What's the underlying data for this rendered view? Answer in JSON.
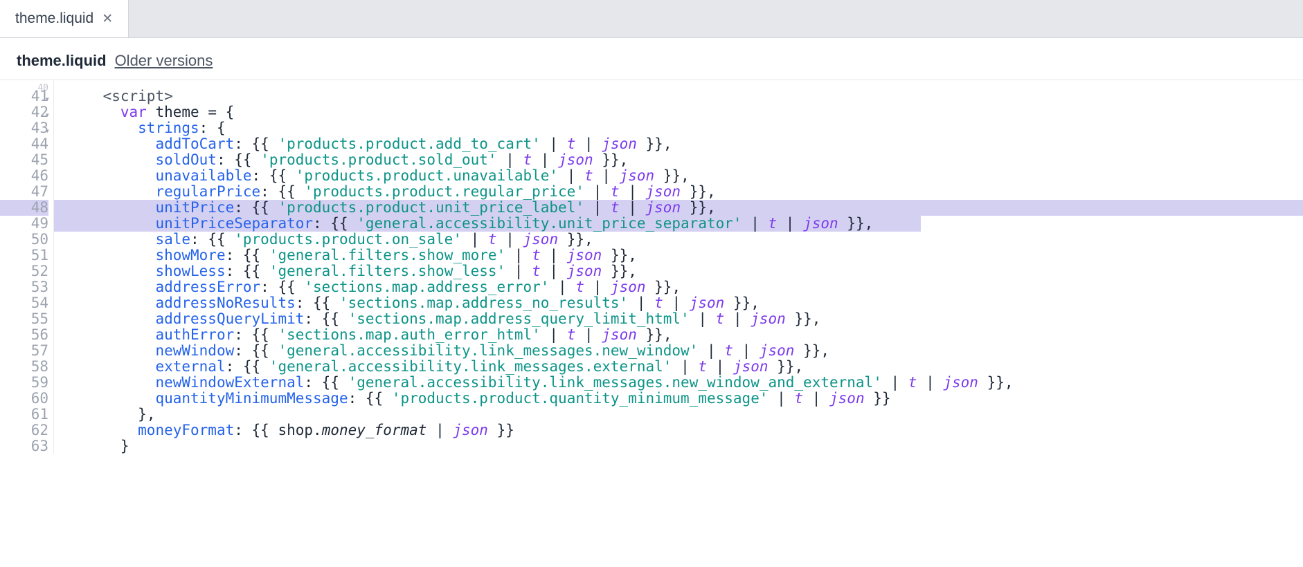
{
  "tab": {
    "title": "theme.liquid",
    "close": "✕"
  },
  "breadcrumb": {
    "file": "theme.liquid",
    "older": "Older versions"
  },
  "gutter_stub": "40",
  "code_lines": [
    {
      "n": "41",
      "fold": true,
      "hl": false,
      "indent": "    ",
      "segs": [
        {
          "t": "<",
          "c": "k-tag"
        },
        {
          "t": "script",
          "c": "k-tag"
        },
        {
          "t": ">",
          "c": "k-tag"
        }
      ]
    },
    {
      "n": "42",
      "fold": true,
      "hl": false,
      "indent": "      ",
      "segs": [
        {
          "t": "var",
          "c": "k-var"
        },
        {
          "t": " theme "
        },
        {
          "t": "=",
          "c": ""
        },
        {
          "t": " "
        },
        {
          "t": "{",
          "c": "k-br"
        }
      ]
    },
    {
      "n": "43",
      "fold": true,
      "hl": false,
      "indent": "        ",
      "segs": [
        {
          "t": "strings",
          "c": "k-prop"
        },
        {
          "t": ": "
        },
        {
          "t": "{",
          "c": "k-br"
        }
      ]
    },
    {
      "n": "44",
      "fold": false,
      "hl": false,
      "indent": "          ",
      "segs": [
        {
          "t": "addToCart",
          "c": "k-prop"
        },
        {
          "t": ": "
        },
        {
          "t": "{{ ",
          "c": "k-br"
        },
        {
          "t": "'products.product.add_to_cart'",
          "c": "k-str"
        },
        {
          "t": " | "
        },
        {
          "t": "t",
          "c": "k-filt"
        },
        {
          "t": " | "
        },
        {
          "t": "json",
          "c": "k-filt"
        },
        {
          "t": " }}",
          "c": "k-br"
        },
        {
          "t": ","
        }
      ]
    },
    {
      "n": "45",
      "fold": false,
      "hl": false,
      "indent": "          ",
      "segs": [
        {
          "t": "soldOut",
          "c": "k-prop"
        },
        {
          "t": ": "
        },
        {
          "t": "{{ ",
          "c": "k-br"
        },
        {
          "t": "'products.product.sold_out'",
          "c": "k-str"
        },
        {
          "t": " | "
        },
        {
          "t": "t",
          "c": "k-filt"
        },
        {
          "t": " | "
        },
        {
          "t": "json",
          "c": "k-filt"
        },
        {
          "t": " }}",
          "c": "k-br"
        },
        {
          "t": ","
        }
      ]
    },
    {
      "n": "46",
      "fold": false,
      "hl": false,
      "indent": "          ",
      "segs": [
        {
          "t": "unavailable",
          "c": "k-prop"
        },
        {
          "t": ": "
        },
        {
          "t": "{{ ",
          "c": "k-br"
        },
        {
          "t": "'products.product.unavailable'",
          "c": "k-str"
        },
        {
          "t": " | "
        },
        {
          "t": "t",
          "c": "k-filt"
        },
        {
          "t": " | "
        },
        {
          "t": "json",
          "c": "k-filt"
        },
        {
          "t": " }}",
          "c": "k-br"
        },
        {
          "t": ","
        }
      ]
    },
    {
      "n": "47",
      "fold": false,
      "hl": false,
      "indent": "          ",
      "segs": [
        {
          "t": "regularPrice",
          "c": "k-prop"
        },
        {
          "t": ": "
        },
        {
          "t": "{{ ",
          "c": "k-br"
        },
        {
          "t": "'products.product.regular_price'",
          "c": "k-str"
        },
        {
          "t": " | "
        },
        {
          "t": "t",
          "c": "k-filt"
        },
        {
          "t": " | "
        },
        {
          "t": "json",
          "c": "k-filt"
        },
        {
          "t": " }}",
          "c": "k-br"
        },
        {
          "t": ","
        }
      ]
    },
    {
      "n": "48",
      "fold": false,
      "hl": true,
      "indent": "          ",
      "segs": [
        {
          "t": "unitPrice",
          "c": "k-prop"
        },
        {
          "t": ": "
        },
        {
          "t": "{{ ",
          "c": "k-br"
        },
        {
          "t": "'products.product.unit_price_label'",
          "c": "k-str"
        },
        {
          "t": " | "
        },
        {
          "t": "t",
          "c": "k-filt"
        },
        {
          "t": " | "
        },
        {
          "t": "json",
          "c": "k-filt"
        },
        {
          "t": " }}",
          "c": "k-br"
        },
        {
          "t": ","
        }
      ]
    },
    {
      "n": "49",
      "fold": false,
      "hl": "partial",
      "indent": "          ",
      "segs": [
        {
          "t": "unitPriceSeparator",
          "c": "k-prop"
        },
        {
          "t": ": "
        },
        {
          "t": "{{ ",
          "c": "k-br"
        },
        {
          "t": "'general.accessibility.unit_price_separator'",
          "c": "k-str"
        },
        {
          "t": " | "
        },
        {
          "t": "t",
          "c": "k-filt"
        },
        {
          "t": " | "
        },
        {
          "t": "json",
          "c": "k-filt"
        },
        {
          "t": " }}",
          "c": "k-br"
        },
        {
          "t": ","
        }
      ]
    },
    {
      "n": "50",
      "fold": false,
      "hl": false,
      "indent": "          ",
      "segs": [
        {
          "t": "sale",
          "c": "k-prop"
        },
        {
          "t": ": "
        },
        {
          "t": "{{ ",
          "c": "k-br"
        },
        {
          "t": "'products.product.on_sale'",
          "c": "k-str"
        },
        {
          "t": " | "
        },
        {
          "t": "t",
          "c": "k-filt"
        },
        {
          "t": " | "
        },
        {
          "t": "json",
          "c": "k-filt"
        },
        {
          "t": " }}",
          "c": "k-br"
        },
        {
          "t": ","
        }
      ]
    },
    {
      "n": "51",
      "fold": false,
      "hl": false,
      "indent": "          ",
      "segs": [
        {
          "t": "showMore",
          "c": "k-prop"
        },
        {
          "t": ": "
        },
        {
          "t": "{{ ",
          "c": "k-br"
        },
        {
          "t": "'general.filters.show_more'",
          "c": "k-str"
        },
        {
          "t": " | "
        },
        {
          "t": "t",
          "c": "k-filt"
        },
        {
          "t": " | "
        },
        {
          "t": "json",
          "c": "k-filt"
        },
        {
          "t": " }}",
          "c": "k-br"
        },
        {
          "t": ","
        }
      ]
    },
    {
      "n": "52",
      "fold": false,
      "hl": false,
      "indent": "          ",
      "segs": [
        {
          "t": "showLess",
          "c": "k-prop"
        },
        {
          "t": ": "
        },
        {
          "t": "{{ ",
          "c": "k-br"
        },
        {
          "t": "'general.filters.show_less'",
          "c": "k-str"
        },
        {
          "t": " | "
        },
        {
          "t": "t",
          "c": "k-filt"
        },
        {
          "t": " | "
        },
        {
          "t": "json",
          "c": "k-filt"
        },
        {
          "t": " }}",
          "c": "k-br"
        },
        {
          "t": ","
        }
      ]
    },
    {
      "n": "53",
      "fold": false,
      "hl": false,
      "indent": "          ",
      "segs": [
        {
          "t": "addressError",
          "c": "k-prop"
        },
        {
          "t": ": "
        },
        {
          "t": "{{ ",
          "c": "k-br"
        },
        {
          "t": "'sections.map.address_error'",
          "c": "k-str"
        },
        {
          "t": " | "
        },
        {
          "t": "t",
          "c": "k-filt"
        },
        {
          "t": " | "
        },
        {
          "t": "json",
          "c": "k-filt"
        },
        {
          "t": " }}",
          "c": "k-br"
        },
        {
          "t": ","
        }
      ]
    },
    {
      "n": "54",
      "fold": false,
      "hl": false,
      "indent": "          ",
      "segs": [
        {
          "t": "addressNoResults",
          "c": "k-prop"
        },
        {
          "t": ": "
        },
        {
          "t": "{{ ",
          "c": "k-br"
        },
        {
          "t": "'sections.map.address_no_results'",
          "c": "k-str"
        },
        {
          "t": " | "
        },
        {
          "t": "t",
          "c": "k-filt"
        },
        {
          "t": " | "
        },
        {
          "t": "json",
          "c": "k-filt"
        },
        {
          "t": " }}",
          "c": "k-br"
        },
        {
          "t": ","
        }
      ]
    },
    {
      "n": "55",
      "fold": false,
      "hl": false,
      "indent": "          ",
      "segs": [
        {
          "t": "addressQueryLimit",
          "c": "k-prop"
        },
        {
          "t": ": "
        },
        {
          "t": "{{ ",
          "c": "k-br"
        },
        {
          "t": "'sections.map.address_query_limit_html'",
          "c": "k-str"
        },
        {
          "t": " | "
        },
        {
          "t": "t",
          "c": "k-filt"
        },
        {
          "t": " | "
        },
        {
          "t": "json",
          "c": "k-filt"
        },
        {
          "t": " }}",
          "c": "k-br"
        },
        {
          "t": ","
        }
      ]
    },
    {
      "n": "56",
      "fold": false,
      "hl": false,
      "indent": "          ",
      "segs": [
        {
          "t": "authError",
          "c": "k-prop"
        },
        {
          "t": ": "
        },
        {
          "t": "{{ ",
          "c": "k-br"
        },
        {
          "t": "'sections.map.auth_error_html'",
          "c": "k-str"
        },
        {
          "t": " | "
        },
        {
          "t": "t",
          "c": "k-filt"
        },
        {
          "t": " | "
        },
        {
          "t": "json",
          "c": "k-filt"
        },
        {
          "t": " }}",
          "c": "k-br"
        },
        {
          "t": ","
        }
      ]
    },
    {
      "n": "57",
      "fold": false,
      "hl": false,
      "indent": "          ",
      "segs": [
        {
          "t": "newWindow",
          "c": "k-prop"
        },
        {
          "t": ": "
        },
        {
          "t": "{{ ",
          "c": "k-br"
        },
        {
          "t": "'general.accessibility.link_messages.new_window'",
          "c": "k-str"
        },
        {
          "t": " | "
        },
        {
          "t": "t",
          "c": "k-filt"
        },
        {
          "t": " | "
        },
        {
          "t": "json",
          "c": "k-filt"
        },
        {
          "t": " }}",
          "c": "k-br"
        },
        {
          "t": ","
        }
      ]
    },
    {
      "n": "58",
      "fold": false,
      "hl": false,
      "indent": "          ",
      "segs": [
        {
          "t": "external",
          "c": "k-prop"
        },
        {
          "t": ": "
        },
        {
          "t": "{{ ",
          "c": "k-br"
        },
        {
          "t": "'general.accessibility.link_messages.external'",
          "c": "k-str"
        },
        {
          "t": " | "
        },
        {
          "t": "t",
          "c": "k-filt"
        },
        {
          "t": " | "
        },
        {
          "t": "json",
          "c": "k-filt"
        },
        {
          "t": " }}",
          "c": "k-br"
        },
        {
          "t": ","
        }
      ]
    },
    {
      "n": "59",
      "fold": false,
      "hl": false,
      "indent": "          ",
      "segs": [
        {
          "t": "newWindowExternal",
          "c": "k-prop"
        },
        {
          "t": ": "
        },
        {
          "t": "{{ ",
          "c": "k-br"
        },
        {
          "t": "'general.accessibility.link_messages.new_window_and_external'",
          "c": "k-str"
        },
        {
          "t": " | "
        },
        {
          "t": "t",
          "c": "k-filt"
        },
        {
          "t": " | "
        },
        {
          "t": "json",
          "c": "k-filt"
        },
        {
          "t": " }}",
          "c": "k-br"
        },
        {
          "t": ","
        }
      ]
    },
    {
      "n": "60",
      "fold": false,
      "hl": false,
      "indent": "          ",
      "segs": [
        {
          "t": "quantityMinimumMessage",
          "c": "k-prop"
        },
        {
          "t": ": "
        },
        {
          "t": "{{ ",
          "c": "k-br"
        },
        {
          "t": "'products.product.quantity_minimum_message'",
          "c": "k-str"
        },
        {
          "t": " | "
        },
        {
          "t": "t",
          "c": "k-filt"
        },
        {
          "t": " | "
        },
        {
          "t": "json",
          "c": "k-filt"
        },
        {
          "t": " }}",
          "c": "k-br"
        }
      ]
    },
    {
      "n": "61",
      "fold": false,
      "hl": false,
      "indent": "        ",
      "segs": [
        {
          "t": "}",
          "c": "k-br"
        },
        {
          "t": ","
        }
      ]
    },
    {
      "n": "62",
      "fold": false,
      "hl": false,
      "indent": "        ",
      "segs": [
        {
          "t": "moneyFormat",
          "c": "k-prop"
        },
        {
          "t": ": "
        },
        {
          "t": "{{ ",
          "c": "k-br"
        },
        {
          "t": "shop",
          "c": "k-shop"
        },
        {
          "t": ".",
          "c": ""
        },
        {
          "t": "money_format",
          "c": "k-ital"
        },
        {
          "t": " | "
        },
        {
          "t": "json",
          "c": "k-filt"
        },
        {
          "t": " }}",
          "c": "k-br"
        }
      ]
    },
    {
      "n": "63",
      "fold": false,
      "hl": false,
      "indent": "      ",
      "segs": [
        {
          "t": "}",
          "c": "k-br"
        }
      ]
    }
  ]
}
